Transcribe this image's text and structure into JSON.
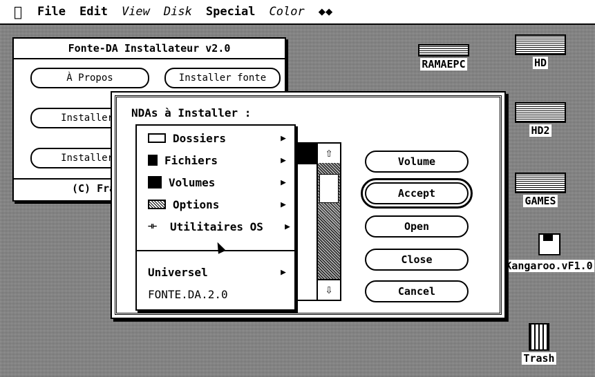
{
  "menubar": {
    "items": [
      {
        "label": "File",
        "dimmed": false
      },
      {
        "label": "Edit",
        "dimmed": false
      },
      {
        "label": "View",
        "dimmed": true
      },
      {
        "label": "Disk",
        "dimmed": true
      },
      {
        "label": "Special",
        "dimmed": false
      },
      {
        "label": "Color",
        "dimmed": true
      }
    ]
  },
  "installer_window": {
    "title": "Fonte-DA Installateur v2.0",
    "buttons": [
      "À Propos",
      "Installer fonte",
      "Installer",
      "Installer"
    ],
    "footer": "(C) Fran"
  },
  "dialog": {
    "prompt": "NDAs à Installer :",
    "menu_items": [
      {
        "label": "Dossiers",
        "icon": "folder-icon"
      },
      {
        "label": "Fichiers",
        "icon": "file-icon"
      },
      {
        "label": "Volumes",
        "icon": "volume-icon"
      },
      {
        "label": "Options",
        "icon": "options-icon"
      },
      {
        "label": "Utilitaires OS",
        "icon": "utilities-icon"
      },
      {
        "label": "Universel",
        "icon": ""
      },
      {
        "label": "FONTE.DA.2.0",
        "icon": ""
      }
    ],
    "buttons": [
      "Volume",
      "Accept",
      "Open",
      "Close",
      "Cancel"
    ],
    "default_button": "Accept"
  },
  "desktop": {
    "icons": [
      {
        "label": "RAMAEPC"
      },
      {
        "label": "HD"
      },
      {
        "label": "HD2"
      },
      {
        "label": "GAMES"
      },
      {
        "label": "Kangaroo.vF1.0"
      },
      {
        "label": "Trash"
      }
    ]
  }
}
